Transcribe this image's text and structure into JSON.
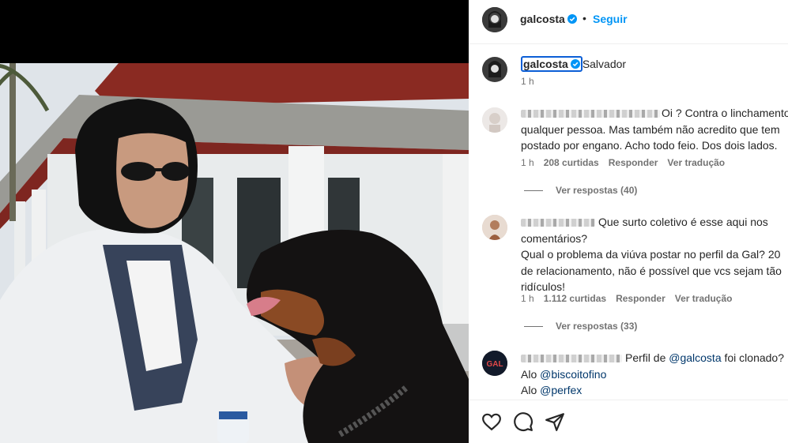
{
  "post": {
    "username": "galcosta",
    "follow_label": "Seguir",
    "dot": "•"
  },
  "caption": {
    "username": "galcosta",
    "text": "Salvador",
    "time": "1 h"
  },
  "comments": [
    {
      "lines": [
        "Oi ? Contra o linchamento de",
        "qualquer pessoa. Mas também não acredito que tem",
        "postado por engano. Acho todo feio. Dos dois lados."
      ],
      "time": "1 h",
      "likes": "208 curtidas",
      "reply": "Responder",
      "translate": "Ver tradução",
      "view_replies": "Ver respostas (40)"
    },
    {
      "lines": [
        "Que surto coletivo é esse aqui nos",
        "comentários?",
        "Qual o problema da viúva postar no perfil da Gal? 20",
        "de relacionamento, não é possível que vcs sejam tão",
        "ridículos!"
      ],
      "time": "1 h",
      "likes": "1.112 curtidas",
      "reply": "Responder",
      "translate": "Ver tradução",
      "view_replies": "Ver respostas (33)"
    },
    {
      "line1_text": "Perfil de ",
      "line1_mention": "@galcosta",
      "line1_tail": " foi clonado?",
      "line2_prefix": "Alo ",
      "line2_mention": "@biscoitofino",
      "line3_prefix": "Alo ",
      "line3_mention": "@perfex"
    }
  ],
  "icons": [
    "verified-badge-icon",
    "heart-icon",
    "comment-icon",
    "share-icon"
  ],
  "colors": {
    "accent": "#0095f6",
    "secondary_text": "#737373",
    "mention": "#00376b"
  }
}
